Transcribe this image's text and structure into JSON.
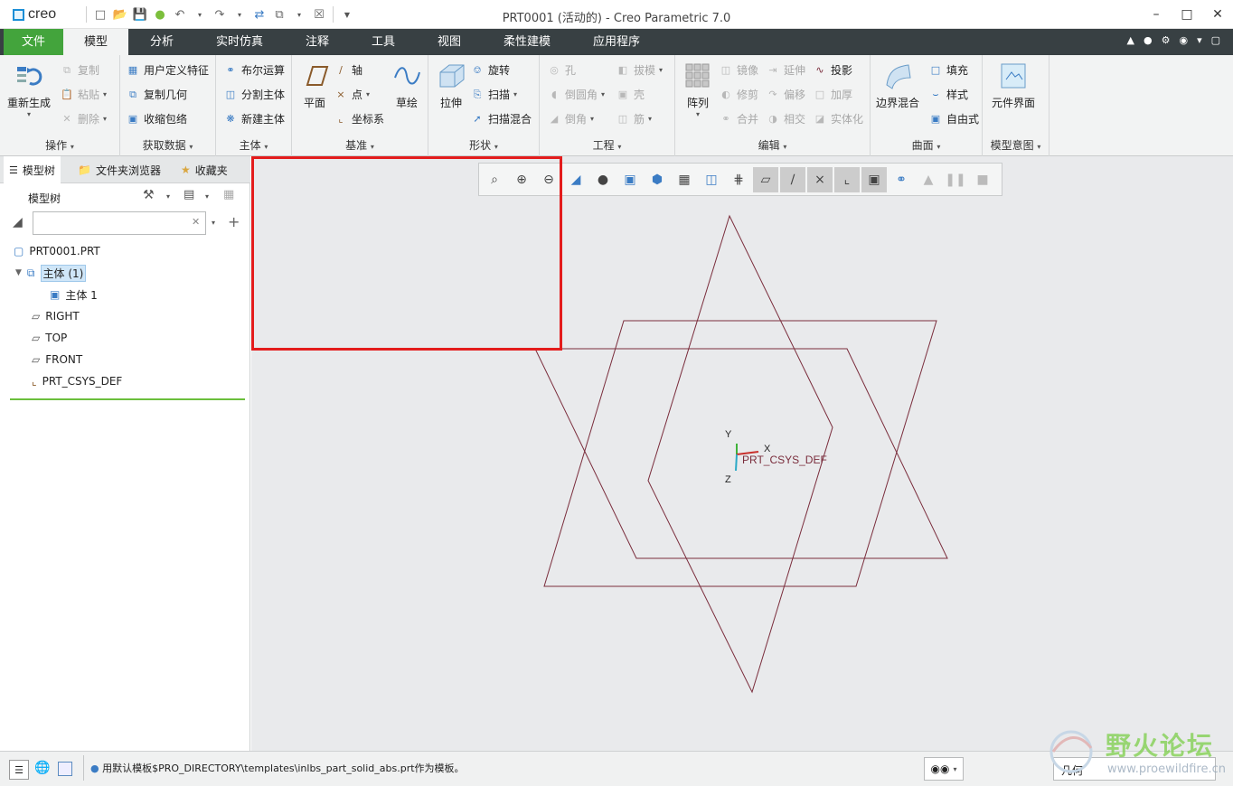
{
  "app": {
    "logo": "creo",
    "window_title": "PRT0001 (活动的) - Creo Parametric 7.0"
  },
  "tabs": [
    "文件",
    "模型",
    "分析",
    "实时仿真",
    "注释",
    "工具",
    "视图",
    "柔性建模",
    "应用程序"
  ],
  "ribbon": {
    "ops": {
      "regen": "重新生成",
      "copy": "复制",
      "paste": "粘贴",
      "delete": "删除",
      "label": "操作"
    },
    "getdata": {
      "udf": "用户定义特征",
      "copygeom": "复制几何",
      "shrinkwrap": "收缩包络",
      "label": "获取数据"
    },
    "body": {
      "boolean": "布尔运算",
      "split": "分割主体",
      "newbody": "新建主体",
      "label": "主体"
    },
    "datum": {
      "plane": "平面",
      "axis": "轴",
      "point": "点",
      "csys": "坐标系",
      "sketch": "草绘",
      "label": "基准"
    },
    "shapes": {
      "extrude": "拉伸",
      "revolve": "旋转",
      "sweep": "扫描",
      "sweptblend": "扫描混合",
      "label": "形状"
    },
    "engineering": {
      "hole": "孔",
      "draft": "拔模",
      "round": "倒圆角",
      "shell": "壳",
      "chamfer": "倒角",
      "rib": "筋",
      "label": "工程"
    },
    "editing": {
      "pattern": "阵列",
      "mirror": "镜像",
      "extend": "延伸",
      "project": "投影",
      "trim": "修剪",
      "offset": "偏移",
      "thicken": "加厚",
      "merge": "合并",
      "intersect": "相交",
      "solidify": "实体化",
      "label": "编辑"
    },
    "surfaces": {
      "boundary": "边界混合",
      "fill": "填充",
      "style": "样式",
      "freestyle": "自由式",
      "label": "曲面"
    },
    "intent": {
      "component": "元件界面",
      "label": "模型意图"
    }
  },
  "navtabs": [
    "模型树",
    "文件夹浏览器",
    "收藏夹"
  ],
  "tree": {
    "header": "模型树",
    "search_placeholder": "",
    "items": [
      "PRT0001.PRT",
      "主体 (1)",
      "主体 1",
      "RIGHT",
      "TOP",
      "FRONT",
      "PRT_CSYS_DEF"
    ]
  },
  "viewport": {
    "csys_label": "PRT_CSYS_DEF",
    "axis_x": "X",
    "axis_y": "Y",
    "axis_z": "Z",
    "datum_color": "#7a2d3c"
  },
  "status": {
    "message": "用默认模板$PRO_DIRECTORY\\templates\\inlbs_part_solid_abs.prt作为模板。",
    "filter": "几何"
  },
  "watermark": {
    "text": "野火论坛",
    "url": "www.proewildfire.cn"
  },
  "colors": {
    "accent": "#43a43c",
    "tabbar": "#384043",
    "highlight": "#e31c1c"
  }
}
